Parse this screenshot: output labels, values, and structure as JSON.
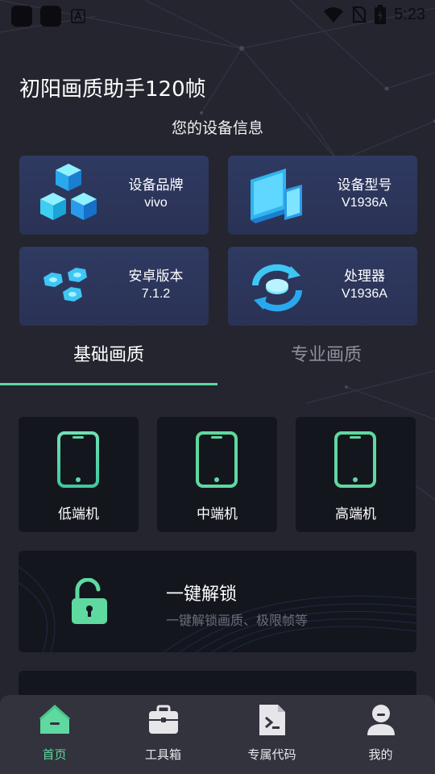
{
  "status_bar": {
    "time": "5:23"
  },
  "app_title": "初阳画质助手120帧",
  "section_title": "您的设备信息",
  "device_info": [
    {
      "label": "设备品牌",
      "value": "vivo",
      "icon": "cubes-icon"
    },
    {
      "label": "设备型号",
      "value": "V1936A",
      "icon": "devices-icon"
    },
    {
      "label": "安卓版本",
      "value": "7.1.2",
      "icon": "nuts-icon"
    },
    {
      "label": "处理器",
      "value": "V1936A",
      "icon": "sync-chip-icon"
    }
  ],
  "tabs": [
    {
      "label": "基础画质",
      "active": true
    },
    {
      "label": "专业画质",
      "active": false
    }
  ],
  "device_tiers": [
    {
      "label": "低端机",
      "icon": "phone-icon"
    },
    {
      "label": "中端机",
      "icon": "phone-icon"
    },
    {
      "label": "高端机",
      "icon": "phone-icon"
    }
  ],
  "unlock": {
    "title": "一键解锁",
    "description": "一键解锁画质、极限帧等",
    "icon": "unlock-icon"
  },
  "bottom_nav": [
    {
      "label": "首页",
      "icon": "home-icon",
      "active": true
    },
    {
      "label": "工具箱",
      "icon": "toolbox-icon",
      "active": false
    },
    {
      "label": "专属代码",
      "icon": "code-file-icon",
      "active": false
    },
    {
      "label": "我的",
      "icon": "profile-icon",
      "active": false
    }
  ],
  "colors": {
    "background": "#24252f",
    "card_info": "#2f3a62",
    "card_dark": "#14161e",
    "accent": "#5ed9a0",
    "icon_blue": "#3ec6f4",
    "nav_bg": "#32333d"
  }
}
